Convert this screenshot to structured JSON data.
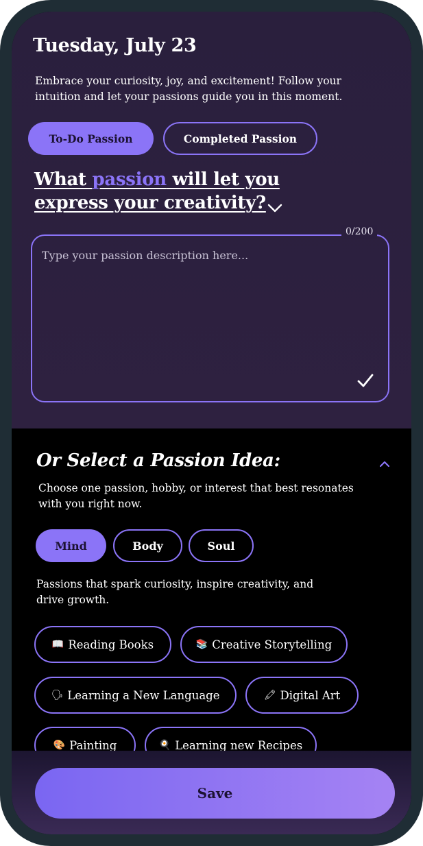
{
  "header": {
    "date": "Tuesday, July 23",
    "intro": "Embrace your curiosity, joy, and excitement! Follow your intuition and let your passions guide you in this moment."
  },
  "tabs": [
    {
      "label": "To-Do Passion",
      "active": true
    },
    {
      "label": "Completed Passion",
      "active": false
    }
  ],
  "question": {
    "line1_prefix": "What ",
    "line1_accent": "passion",
    "line1_suffix": " will let you",
    "line2": "express your creativity?"
  },
  "description_input": {
    "placeholder": "Type your passion description here...",
    "value": "",
    "counter": "0/200"
  },
  "ideas": {
    "title": "Or Select a Passion Idea:",
    "subtitle": "Choose one passion, hobby, or interest that best resonates with you right now.",
    "categories": [
      {
        "label": "Mind",
        "active": true
      },
      {
        "label": "Body",
        "active": false
      },
      {
        "label": "Soul",
        "active": false
      }
    ],
    "category_description": "Passions that spark curiosity, inspire creativity, and drive growth.",
    "chips": [
      {
        "icon": "open-book-icon",
        "glyph": "📖",
        "label": "Reading Books"
      },
      {
        "icon": "books-icon",
        "glyph": "📚",
        "label": "Creative Storytelling"
      },
      {
        "icon": "speech-bubble-icon",
        "glyph": "🗣",
        "label": "Learning a New Language"
      },
      {
        "icon": "crayon-icon",
        "glyph": "🖍",
        "label": "Digital Art"
      },
      {
        "icon": "palette-icon",
        "glyph": "🎨",
        "label": "Painting"
      },
      {
        "icon": "chef-icon",
        "glyph": "🍳",
        "label": "Learning new Recipes"
      }
    ]
  },
  "actions": {
    "save_label": "Save"
  },
  "colors": {
    "accent": "#8b74f7",
    "top_panel_background": "#2a1f3d",
    "page_background": "#000000",
    "phone_frame": "#1f2d35"
  }
}
